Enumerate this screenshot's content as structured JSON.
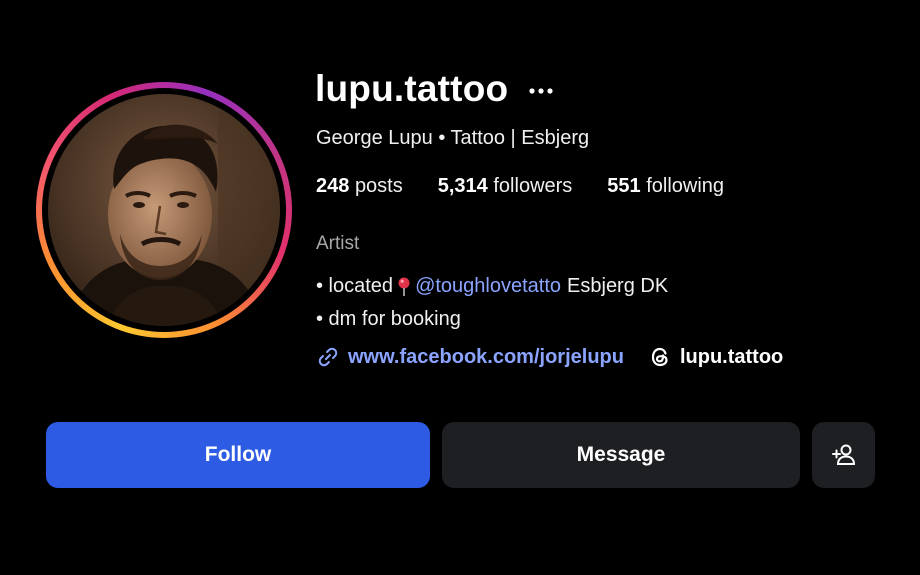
{
  "profile": {
    "username": "lupu.tattoo",
    "subtitle": "George Lupu • Tattoo | Esbjerg",
    "category": "Artist"
  },
  "stats": [
    {
      "count": "248",
      "label": "posts"
    },
    {
      "count": "5,314",
      "label": "followers"
    },
    {
      "count": "551",
      "label": "following"
    }
  ],
  "bio": {
    "line1_prefix": "• located",
    "line1_mention": "@toughlovetatto",
    "line1_suffix": "Esbjerg DK",
    "line2": "• dm for booking"
  },
  "links": {
    "website": "www.facebook.com/jorjelupu",
    "threads": "lupu.tattoo"
  },
  "buttons": {
    "follow": "Follow",
    "message": "Message"
  },
  "colors": {
    "follow_button": "#2d5be3",
    "link": "#8aa4ff",
    "secondary_button": "#1e1f23"
  },
  "icons": [
    "more-icon",
    "location-pin-icon",
    "link-icon",
    "threads-icon",
    "add-person-icon"
  ]
}
